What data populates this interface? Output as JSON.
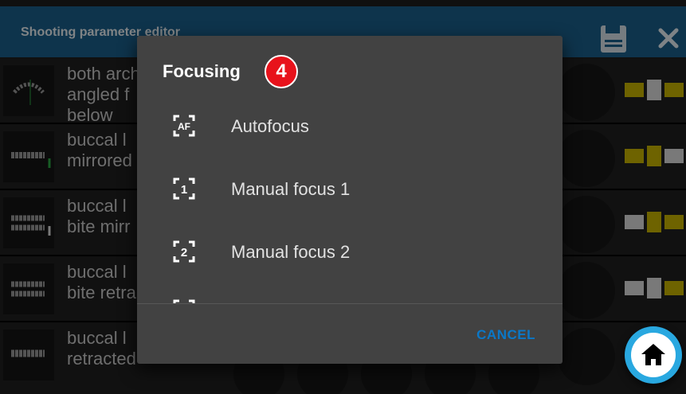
{
  "appbar": {
    "title": "Shooting parameter editor"
  },
  "rows": [
    {
      "label": "both arch\nangled f\nbelow"
    },
    {
      "label": "buccal l\nmirrored"
    },
    {
      "label": "buccal l\nbite mirr"
    },
    {
      "label": "buccal l\nbite retra"
    },
    {
      "label": "buccal l\nretracted"
    }
  ],
  "dialog": {
    "title": "Focusing",
    "badge": "4",
    "options": [
      {
        "label": "Autofocus",
        "icon": "autofocus-icon"
      },
      {
        "label": "Manual focus 1",
        "icon": "manual-focus-1-icon"
      },
      {
        "label": "Manual focus 2",
        "icon": "manual-focus-2-icon"
      }
    ],
    "cancel_label": "CANCEL"
  },
  "colors": {
    "appbar": "#1a5f8a",
    "dialog_bg": "#424242",
    "badge": "#e8121b",
    "cancel": "#0a78c8",
    "home_fab": "#29a8e0",
    "accent_yellow": "#c8b400"
  }
}
